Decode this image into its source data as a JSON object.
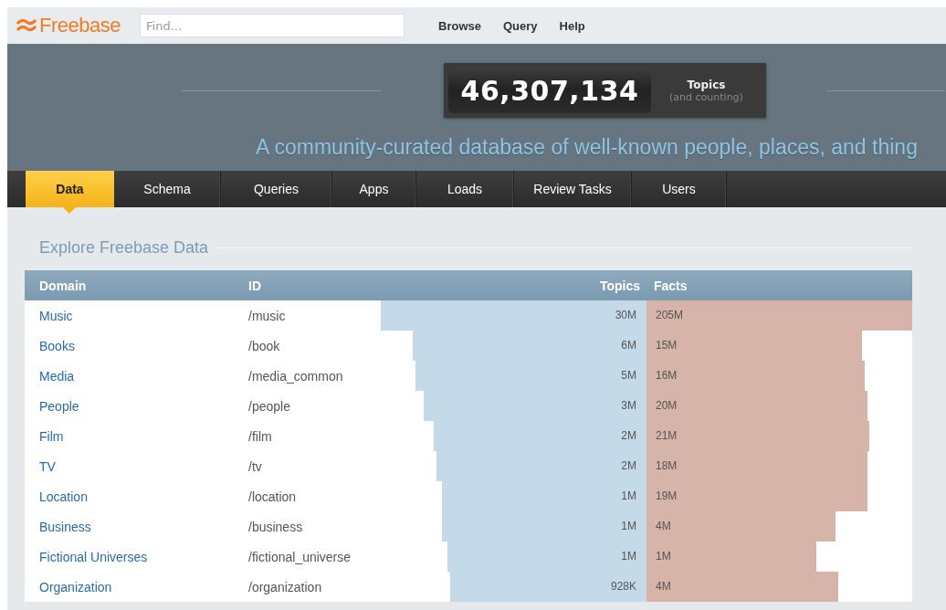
{
  "topbar": {
    "logo": "Freebase",
    "search": {
      "placeholder": "Find..."
    },
    "links": [
      "Browse",
      "Query",
      "Help"
    ]
  },
  "header": {
    "count": "46,307,134",
    "count_label": "Topics",
    "count_note": "(and counting)",
    "tagline": "A community-curated database of well-known people, places, and thing"
  },
  "tabs": [
    {
      "label": "Data",
      "selected": true
    },
    {
      "label": "Schema",
      "selected": false
    },
    {
      "label": "Queries",
      "selected": false
    },
    {
      "label": "Apps",
      "selected": false
    },
    {
      "label": "Loads",
      "selected": false
    },
    {
      "label": "Review Tasks",
      "selected": false
    },
    {
      "label": "Users",
      "selected": false
    }
  ],
  "section_title": "Explore Freebase Data",
  "table": {
    "columns": [
      "Domain",
      "ID",
      "Topics",
      "Facts"
    ],
    "rows": [
      {
        "domain": "Music",
        "id": "/music",
        "topics": "30M",
        "topics_bar": {
          "level": 1
        },
        "facts": "205M",
        "facts_bar": {
          "level": 1
        }
      },
      {
        "domain": "Books",
        "id": "/book",
        "topics": "6M",
        "topics_bar": {
          "level": 0.88
        },
        "facts": "15M",
        "facts_bar": {
          "level": 0.81
        }
      },
      {
        "domain": "Media",
        "id": "/media_common",
        "topics": "5M",
        "topics_bar": {
          "level": 0.87
        },
        "facts": "16M",
        "facts_bar": {
          "level": 0.82
        }
      },
      {
        "domain": "People",
        "id": "/people",
        "topics": "3M",
        "topics_bar": {
          "level": 0.84
        },
        "facts": "20M",
        "facts_bar": {
          "level": 0.83
        }
      },
      {
        "domain": "Film",
        "id": "/film",
        "topics": "2M",
        "topics_bar": {
          "level": 0.8
        },
        "facts": "21M",
        "facts_bar": {
          "level": 0.84
        }
      },
      {
        "domain": "TV",
        "id": "/tv",
        "topics": "2M",
        "topics_bar": {
          "level": 0.79
        },
        "facts": "18M",
        "facts_bar": {
          "level": 0.83
        }
      },
      {
        "domain": "Location",
        "id": "/location",
        "topics": "1M",
        "topics_bar": {
          "level": 0.77
        },
        "facts": "19M",
        "facts_bar": {
          "level": 0.83
        }
      },
      {
        "domain": "Business",
        "id": "/business",
        "topics": "1M",
        "topics_bar": {
          "level": 0.77
        },
        "facts": "4M",
        "facts_bar": {
          "level": 0.71
        }
      },
      {
        "domain": "Fictional Universes",
        "id": "/fictional_universe",
        "topics": "1M",
        "topics_bar": {
          "level": 0.75
        },
        "facts": "1M",
        "facts_bar": {
          "level": 0.64
        }
      },
      {
        "domain": "Organization",
        "id": "/organization",
        "topics": "928K",
        "topics_bar": {
          "level": 0.74
        },
        "facts": "4M",
        "facts_bar": {
          "level": 0.72
        }
      }
    ]
  }
}
